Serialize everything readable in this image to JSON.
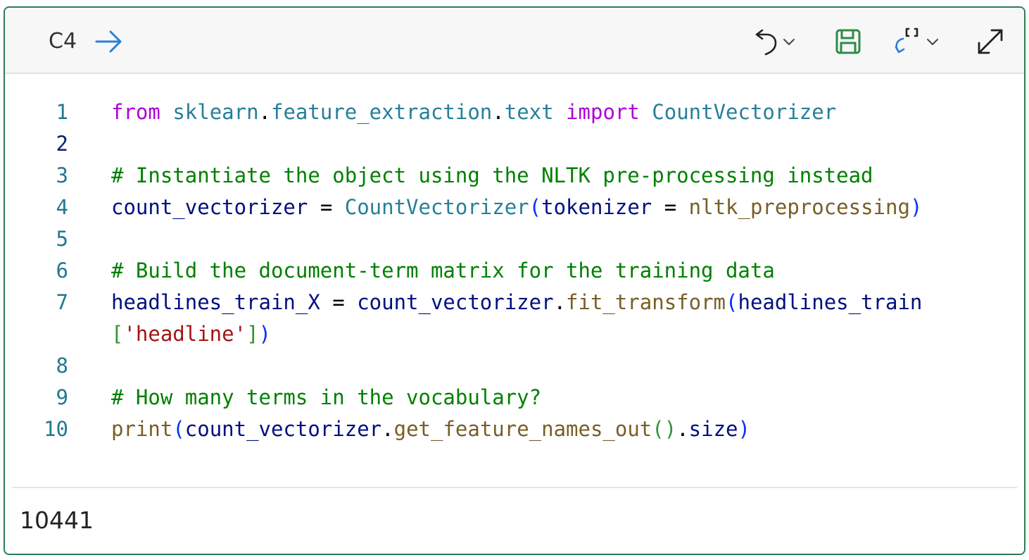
{
  "cell": {
    "label": "C4",
    "toolbar": {
      "undo_icon": "undo-icon",
      "save_icon": "save-icon",
      "cell_action_icon": "cell-action-icon",
      "expand_icon": "expand-icon"
    }
  },
  "code": {
    "line_numbers": [
      "1",
      "2",
      "3",
      "4",
      "5",
      "6",
      "7",
      "8",
      "9",
      "10"
    ],
    "lines": [
      {
        "tokens": [
          {
            "t": "from",
            "c": "kw"
          },
          {
            "t": " ",
            "c": "plain"
          },
          {
            "t": "sklearn",
            "c": "mod"
          },
          {
            "t": ".",
            "c": "plain"
          },
          {
            "t": "feature_extraction",
            "c": "mod"
          },
          {
            "t": ".",
            "c": "plain"
          },
          {
            "t": "text",
            "c": "mod"
          },
          {
            "t": " ",
            "c": "plain"
          },
          {
            "t": "import",
            "c": "kw"
          },
          {
            "t": " ",
            "c": "plain"
          },
          {
            "t": "CountVectorizer",
            "c": "cls"
          }
        ]
      },
      {
        "tokens": []
      },
      {
        "tokens": [
          {
            "t": "# Instantiate the object using the NLTK pre-processing instead",
            "c": "cm"
          }
        ]
      },
      {
        "tokens": [
          {
            "t": "count_vectorizer",
            "c": "var"
          },
          {
            "t": " = ",
            "c": "plain"
          },
          {
            "t": "CountVectorizer",
            "c": "cls"
          },
          {
            "t": "(",
            "c": "p1"
          },
          {
            "t": "tokenizer",
            "c": "var"
          },
          {
            "t": " = ",
            "c": "plain"
          },
          {
            "t": "nltk_preprocessing",
            "c": "fn"
          },
          {
            "t": ")",
            "c": "p1"
          }
        ]
      },
      {
        "tokens": []
      },
      {
        "tokens": [
          {
            "t": "# Build the document-term matrix for the training data",
            "c": "cm"
          }
        ]
      },
      {
        "tokens": [
          {
            "t": "headlines_train_X",
            "c": "var"
          },
          {
            "t": " = ",
            "c": "plain"
          },
          {
            "t": "count_vectorizer",
            "c": "var"
          },
          {
            "t": ".",
            "c": "plain"
          },
          {
            "t": "fit_transform",
            "c": "fn"
          },
          {
            "t": "(",
            "c": "p1"
          },
          {
            "t": "headlines_train",
            "c": "var"
          }
        ]
      },
      {
        "continuation": true,
        "tokens": [
          {
            "t": "[",
            "c": "p2"
          },
          {
            "t": "'headline'",
            "c": "str"
          },
          {
            "t": "]",
            "c": "p2"
          },
          {
            "t": ")",
            "c": "p1"
          }
        ]
      },
      {
        "tokens": []
      },
      {
        "tokens": [
          {
            "t": "# How many terms in the vocabulary?",
            "c": "cm"
          }
        ]
      },
      {
        "tokens": [
          {
            "t": "print",
            "c": "fn"
          },
          {
            "t": "(",
            "c": "p1"
          },
          {
            "t": "count_vectorizer",
            "c": "var"
          },
          {
            "t": ".",
            "c": "plain"
          },
          {
            "t": "get_feature_names_out",
            "c": "fn"
          },
          {
            "t": "(",
            "c": "p2"
          },
          {
            "t": ")",
            "c": "p2"
          },
          {
            "t": ".",
            "c": "plain"
          },
          {
            "t": "size",
            "c": "var"
          },
          {
            "t": ")",
            "c": "p1"
          }
        ]
      }
    ]
  },
  "output": {
    "text": "10441"
  },
  "colors": {
    "cell_border": "#2e7d54",
    "keyword": "#af00db",
    "class": "#267f99",
    "function": "#795e26",
    "comment": "#008000",
    "string": "#a31515",
    "variable": "#001080"
  }
}
